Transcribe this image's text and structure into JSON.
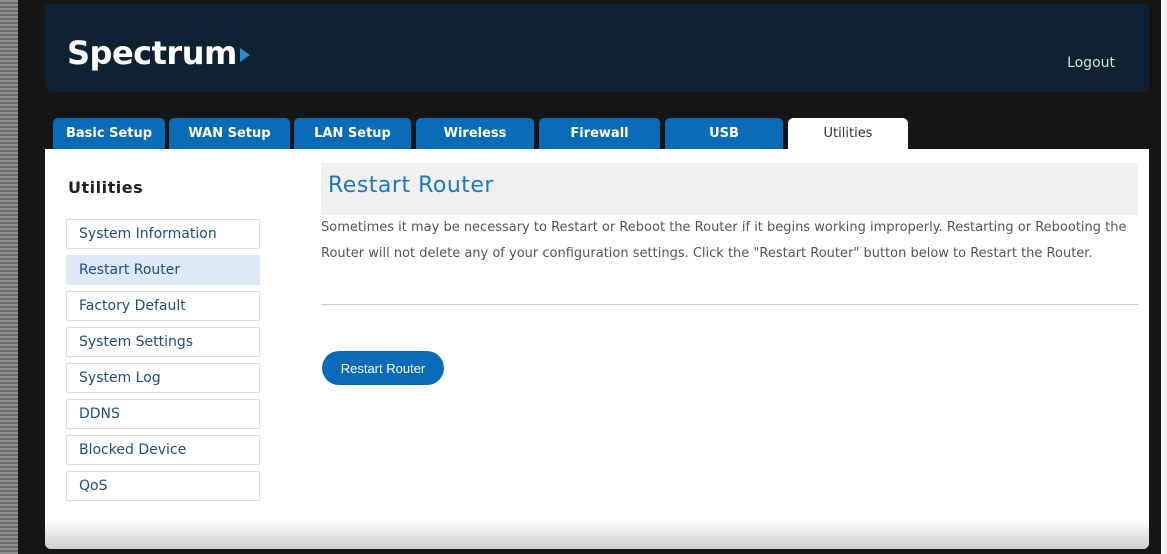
{
  "header": {
    "logo_text": "Spectrum",
    "logout_label": "Logout"
  },
  "tabs": [
    {
      "label": "Basic Setup",
      "active": false
    },
    {
      "label": "WAN Setup",
      "active": false
    },
    {
      "label": "LAN Setup",
      "active": false
    },
    {
      "label": "Wireless",
      "active": false
    },
    {
      "label": "Firewall",
      "active": false
    },
    {
      "label": "USB",
      "active": false
    },
    {
      "label": "Utilities",
      "active": true
    }
  ],
  "sidebar": {
    "title": "Utilities",
    "items": [
      {
        "label": "System Information",
        "active": false
      },
      {
        "label": "Restart Router",
        "active": true
      },
      {
        "label": "Factory Default",
        "active": false
      },
      {
        "label": "System Settings",
        "active": false
      },
      {
        "label": "System Log",
        "active": false
      },
      {
        "label": "DDNS",
        "active": false
      },
      {
        "label": "Blocked Device",
        "active": false
      },
      {
        "label": "QoS",
        "active": false
      }
    ]
  },
  "main": {
    "title": "Restart Router",
    "description": "Sometimes it may be necessary to Restart or Reboot the Router if it begins working improperly. Restarting or Rebooting the Router will not delete any of your configuration settings. Click the \"Restart Router\" button below to Restart the Router.",
    "button_label": "Restart Router"
  },
  "colors": {
    "header_bg": "#0e2233",
    "tab_blue": "#0a6cb8",
    "title_blue": "#1b78c2",
    "link_blue": "#1d4f7c"
  },
  "icons": {
    "logo": "spectrum-arrow-icon"
  }
}
